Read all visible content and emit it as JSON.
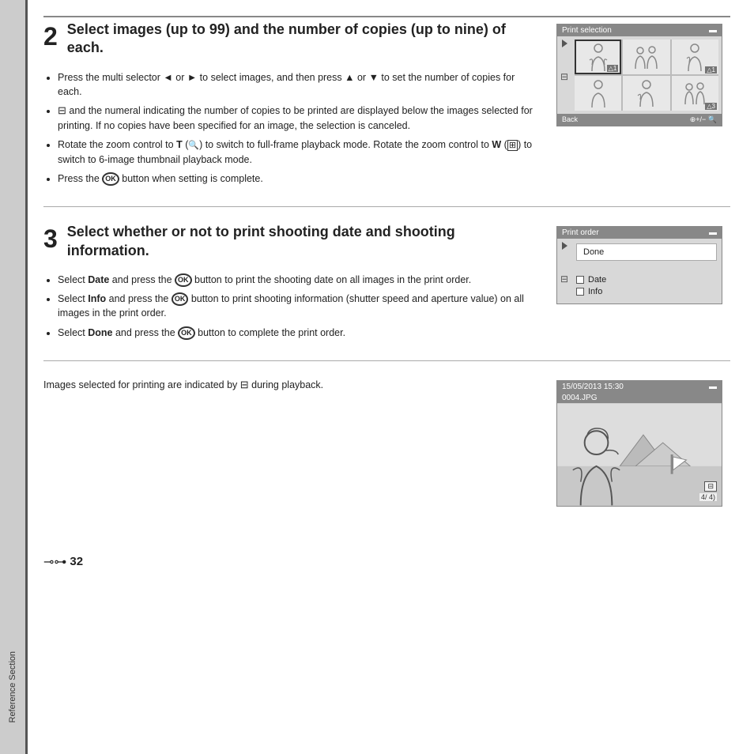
{
  "page": {
    "footer_page_num": "32",
    "sidebar_label": "Reference Section"
  },
  "step2": {
    "number": "2",
    "title": "Select images (up to 99) and the number of copies (up to nine) of each.",
    "bullets": [
      "Press the multi selector ◄ or ► to select images, and then press ▲ or ▼ to set the number of copies for each.",
      "🖨 and the numeral indicating the number of copies to be printed are displayed below the images selected for printing. If no copies have been specified for an image, the selection is canceled.",
      "Rotate the zoom control to T (🔍) to switch to full-frame playback mode. Rotate the zoom control to W (⊞) to switch to 6-image thumbnail playback mode.",
      "Press the ⊙ button when setting is complete."
    ],
    "screen_title": "Print selection",
    "screen_battery": "🔋",
    "screen_footer_left": "Back",
    "screen_footer_right": "⊕+/− 🔍"
  },
  "step3": {
    "number": "3",
    "title": "Select whether or not to print shooting date and shooting information.",
    "bullets": [
      "Select Date and press the ⊙ button to print the shooting date on all images in the print order.",
      "Select Info and press the ⊙ button to print shooting information (shutter speed and aperture value) on all images in the print order.",
      "Select Done and press the ⊙ button to complete the print order."
    ],
    "screen_title": "Print order",
    "screen_done": "Done",
    "screen_date_label": "Date",
    "screen_info_label": "Info"
  },
  "bottom": {
    "text": "Images selected for printing are indicated by 🖨 during playback.",
    "playback_date": "15/05/2013  15:30",
    "playback_file": "0004.JPG",
    "playback_count": "4/  4)"
  }
}
